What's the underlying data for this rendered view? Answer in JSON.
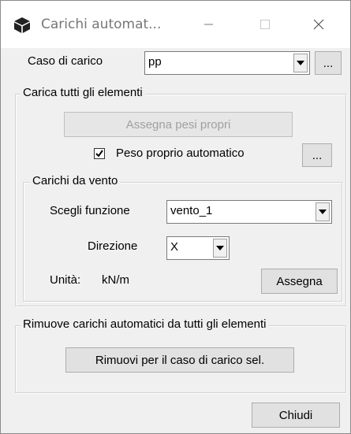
{
  "window": {
    "title": "Carichi automat...",
    "icons": {
      "app": "cube-icon",
      "minimize": "minimize-icon",
      "maximize": "maximize-icon",
      "close": "close-icon"
    }
  },
  "load_case": {
    "label": "Caso di carico",
    "value": "pp",
    "more_button": "..."
  },
  "load_all": {
    "group_title": "Carica tutti gli elementi",
    "assign_self_weight_button": "Assegna pesi propri",
    "auto_self_weight_label": "Peso proprio automatico",
    "auto_self_weight_checked": true,
    "more_button": "..."
  },
  "wind": {
    "group_title": "Carichi da vento",
    "function_label": "Scegli funzione",
    "function_value": "vento_1",
    "direction_label": "Direzione",
    "direction_value": "X",
    "unit_label": "Unità:",
    "unit_value": "kN/m",
    "assign_button": "Assegna"
  },
  "remove": {
    "group_title": "Rimuove carichi automatici da tutti gli elementi",
    "remove_button": "Rimuovi per il caso di carico sel."
  },
  "footer": {
    "close_button": "Chiudi"
  }
}
